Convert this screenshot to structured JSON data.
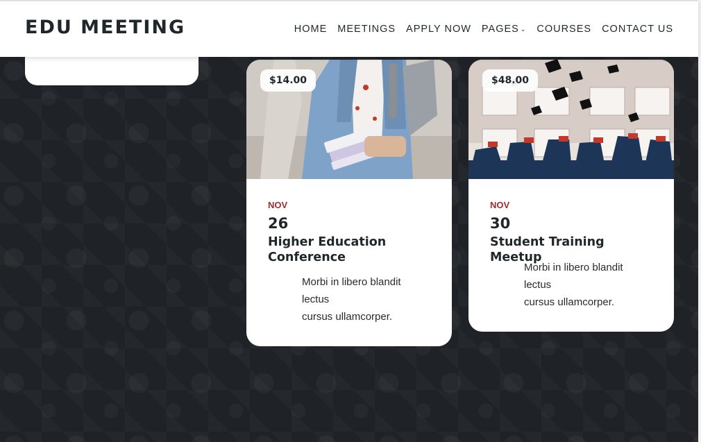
{
  "header": {
    "logo": "EDU MEETING",
    "nav": [
      {
        "label": "HOME"
      },
      {
        "label": "MEETINGS"
      },
      {
        "label": "APPLY NOW"
      },
      {
        "label": "PAGES",
        "dropdown": true
      },
      {
        "label": "COURSES"
      },
      {
        "label": "CONTACT US"
      }
    ]
  },
  "cards": [
    {
      "price": "$14.00",
      "month": "NOV",
      "day": "26",
      "title": "Higher Education Conference",
      "desc_lines": [
        "Morbi in libero blandit",
        "lectus",
        "cursus ullamcorper."
      ]
    },
    {
      "price": "$48.00",
      "month": "NOV",
      "day": "30",
      "title": "Student Training Meetup",
      "desc_lines": [
        "Morbi in libero blandit",
        "lectus",
        "cursus ullamcorper."
      ]
    }
  ],
  "colors": {
    "background": "#1f2327",
    "accent": "#a12c2f",
    "text": "#1f272b"
  }
}
